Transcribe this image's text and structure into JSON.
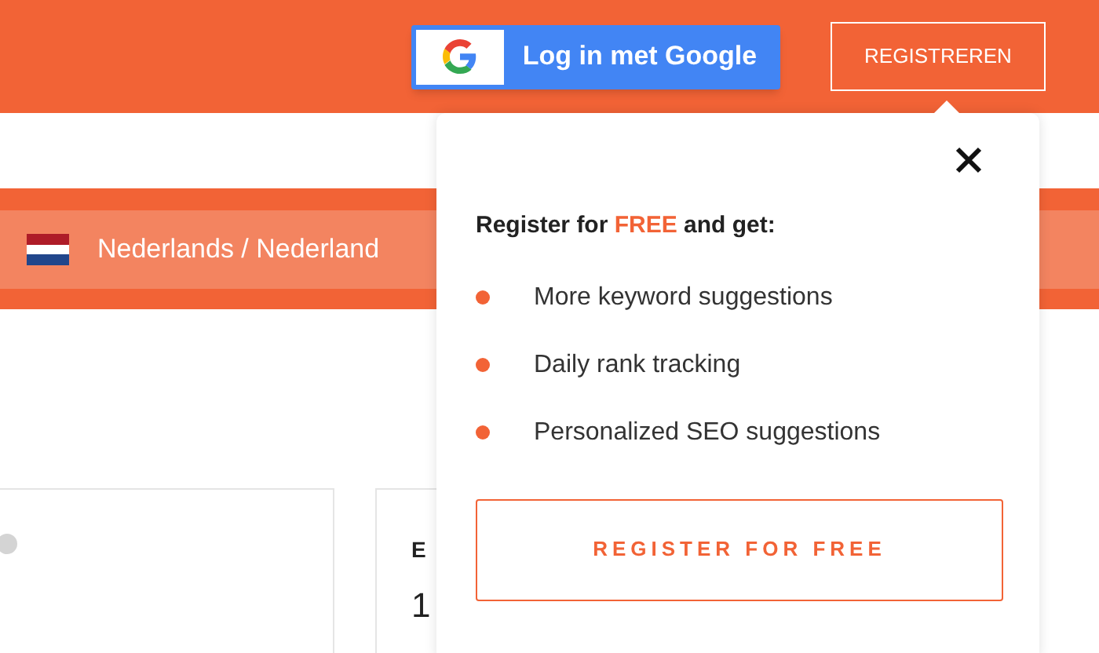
{
  "header": {
    "google_button": "Log in met Google",
    "register_button": "REGISTREREN"
  },
  "language_bar": {
    "label": "Nederlands / Nederland"
  },
  "cards": [
    {
      "kind": "help"
    },
    {
      "kind": "stat",
      "texts": [
        "E",
        "1"
      ]
    }
  ],
  "popup": {
    "heading": [
      "Register for ",
      "FREE",
      " and get:"
    ],
    "benefits": [
      "More keyword suggestions",
      "Daily rank tracking",
      "Personalized SEO suggestions"
    ],
    "cta": "REGISTER FOR FREE"
  }
}
